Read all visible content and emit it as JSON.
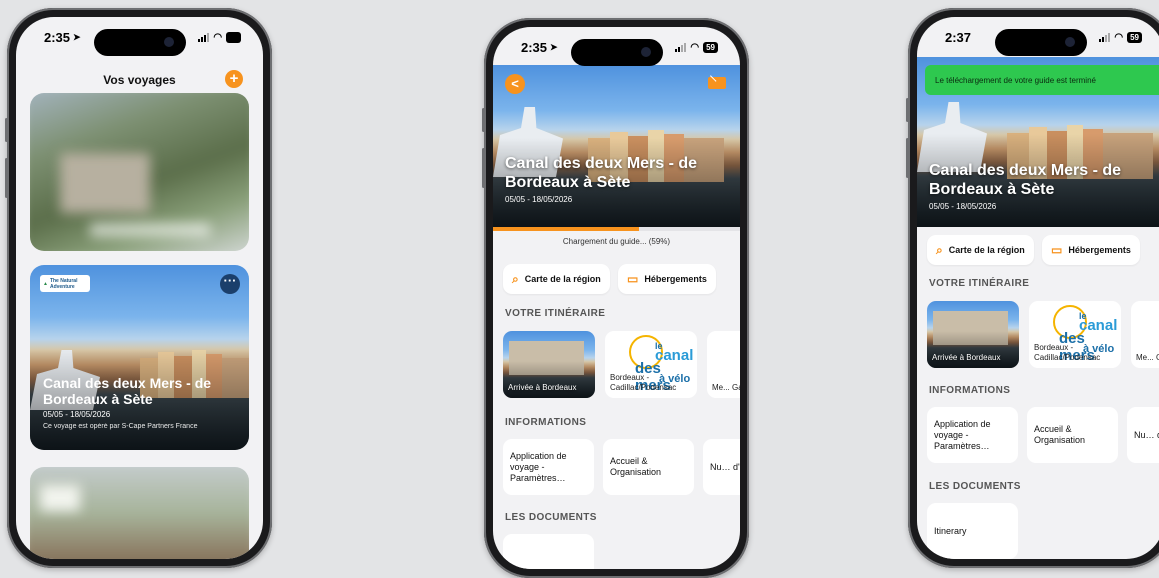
{
  "status": {
    "time1": "2:35",
    "time2": "2:35",
    "time3": "2:37",
    "battery": "59"
  },
  "list": {
    "title": "Vos voyages",
    "add": "+",
    "card": {
      "logo_text": "The Natural Adventure",
      "more": "···",
      "title": "Canal des deux Mers - de Bordeaux à Sète",
      "dates": "05/05 - 18/05/2026",
      "operator": "Ce voyage est opéré par S-Cape Partners France"
    }
  },
  "guide": {
    "back": "<",
    "title": "Canal des deux Mers - de Bordeaux à Sète",
    "dates": "05/05 - 18/05/2026",
    "download": {
      "label": "Chargement du guide... (59%)",
      "progress": 0.59
    },
    "btn_map": "Carte de la région",
    "btn_lodging": "Hébergements",
    "itinerary_heading": "VOTRE ITINÉRAIRE",
    "itinerary": [
      {
        "label": "Arrivée à Bordeaux"
      },
      {
        "label": "Bordeaux - Cadillac/Podensac"
      },
      {
        "label": "Me... Ga..."
      }
    ],
    "canal_logo": {
      "le": "le",
      "canal": "canal",
      "des_mers": "des mers",
      "a_velo": "à vélo"
    },
    "info_heading": "INFORMATIONS",
    "info": [
      "Application de voyage - Paramètres…",
      "Accueil & Organisation",
      "Nu… d'u…"
    ],
    "docs_heading": "LES DOCUMENTS",
    "docs": [
      "Itinerary"
    ]
  },
  "toast": "Le téléchargement de votre guide est terminé",
  "colors": {
    "accent": "#f7931e",
    "success": "#2ec84f",
    "background": "#f2f2f4"
  }
}
